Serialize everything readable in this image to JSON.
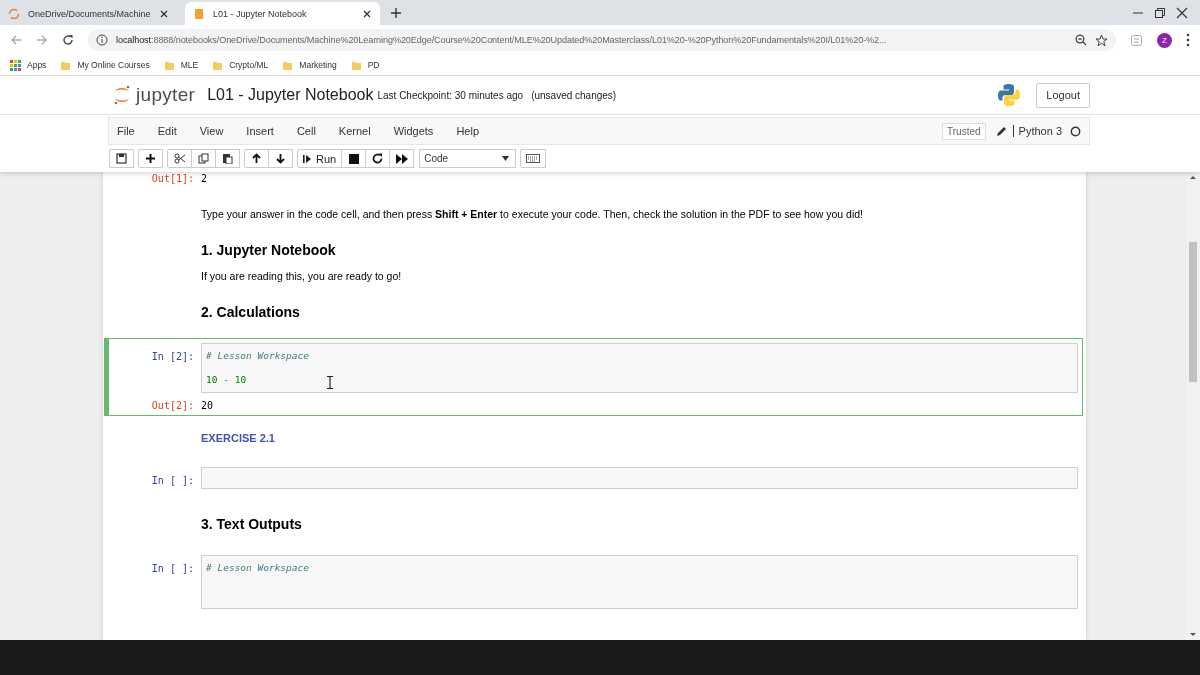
{
  "browser": {
    "tabs": [
      {
        "title": "OneDrive/Documents/Machine",
        "selected": false
      },
      {
        "title": "L01 - Jupyter Notebook",
        "selected": true
      }
    ],
    "url_host": "localhost",
    "url_rest": ":8888/notebooks/OneDrive/Documents/Machine%20Learning%20Edge/Course%20Content/MLE%20Updated%20Masterclass/L01%20-%20Python%20Fundamentals%20I/L01%20-%2...",
    "profile_initial": "Z",
    "bookmarks": [
      {
        "kind": "apps",
        "label": "Apps"
      },
      {
        "kind": "folder",
        "label": "My Online Courses"
      },
      {
        "kind": "folder",
        "label": "MLE"
      },
      {
        "kind": "folder",
        "label": "Crypto/ML"
      },
      {
        "kind": "folder",
        "label": "Marketing"
      },
      {
        "kind": "folder",
        "label": "PD"
      }
    ]
  },
  "header": {
    "logo": "jupyter",
    "title": "L01 - Jupyter Notebook",
    "checkpoint": "Last Checkpoint: 30 minutes ago",
    "unsaved": "(unsaved changes)",
    "logout": "Logout"
  },
  "menu": [
    "File",
    "Edit",
    "View",
    "Insert",
    "Cell",
    "Kernel",
    "Widgets",
    "Help"
  ],
  "trusted": "Trusted",
  "kernel": "Python 3",
  "toolbar": {
    "run": "Run",
    "cell_type": "Code"
  },
  "cells": [
    {
      "kind": "output",
      "prompt": "Out[1]:",
      "text": "2"
    },
    {
      "kind": "text",
      "text": "Type your answer in the code cell, and then press **Shift + Enter** to execute your code. Then, check the solution in the PDF to see how you did!"
    },
    {
      "kind": "heading",
      "text": "1. Jupyter Notebook"
    },
    {
      "kind": "text",
      "text": "If you are reading this, you are ready to go!"
    },
    {
      "kind": "heading",
      "text": "2. Calculations"
    },
    {
      "kind": "code",
      "prompt": "In [2]:",
      "selected": true,
      "lines": [
        {
          "kind": "comment",
          "text": "# Lesson Workspace"
        },
        {
          "kind": "numbers",
          "parts": [
            "10",
            "-",
            "10"
          ]
        }
      ],
      "out_prompt": "Out[2]:",
      "output": "20"
    },
    {
      "kind": "label",
      "text": "EXERCISE 2.1"
    },
    {
      "kind": "code",
      "prompt": "In [ ]:",
      "selected": false
    },
    {
      "kind": "heading",
      "text": "3. Text Outputs"
    },
    {
      "kind": "code",
      "prompt": "In [ ]:",
      "selected": false,
      "lines": [
        {
          "kind": "comment",
          "text": "# Lesson Workspace"
        }
      ]
    }
  ]
}
